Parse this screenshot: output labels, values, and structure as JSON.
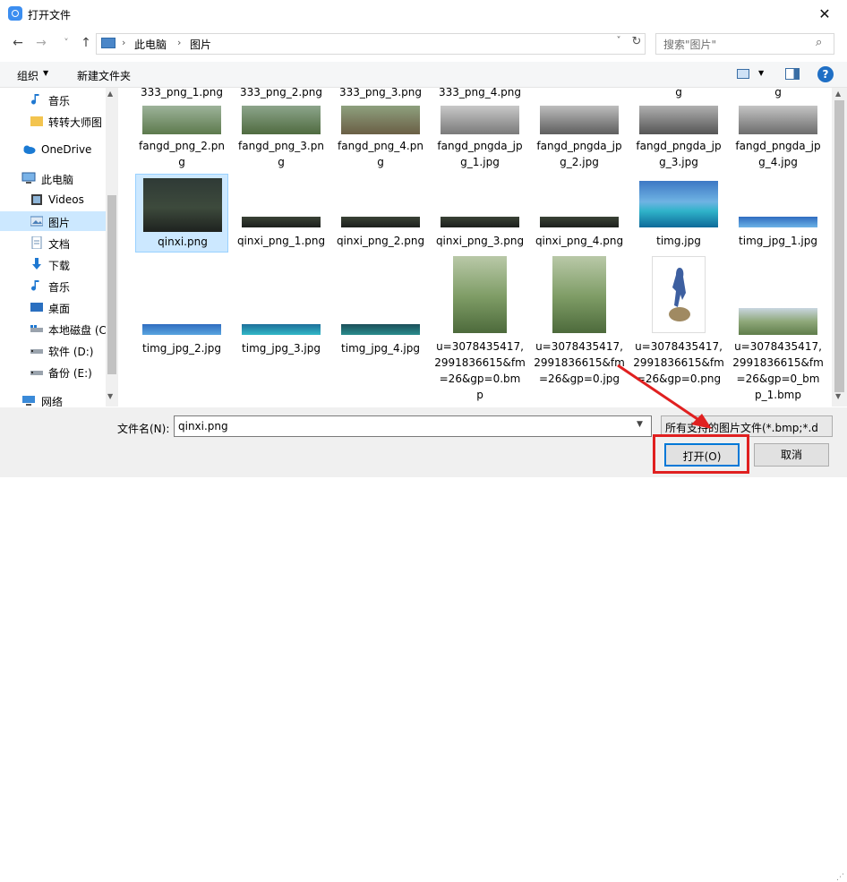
{
  "window": {
    "title": "打开文件",
    "close": "✕"
  },
  "nav": {
    "back": "←",
    "forward": "→",
    "recent": "˅",
    "up": "↑",
    "breadcrumb": [
      "此电脑",
      "图片"
    ],
    "crumb_sep": "›",
    "dropdown": "˅",
    "refresh": "↻",
    "search_placeholder": "搜索\"图片\"",
    "search_icon": "⌕"
  },
  "toolbar": {
    "organize": "组织",
    "organize_arrow": "▼",
    "new_folder": "新建文件夹",
    "view_arrow": "▼",
    "help": "?"
  },
  "sidebar": {
    "items": [
      {
        "label": "音乐",
        "icon": "music-icon"
      },
      {
        "label": "转转大师图",
        "icon": "folder-icon"
      },
      {
        "label": "OneDrive",
        "icon": "cloud-icon"
      },
      {
        "label": "此电脑",
        "icon": "computer-icon"
      },
      {
        "label": "Videos",
        "icon": "video-icon"
      },
      {
        "label": "图片",
        "icon": "pictures-icon"
      },
      {
        "label": "文档",
        "icon": "document-icon"
      },
      {
        "label": "下载",
        "icon": "download-icon"
      },
      {
        "label": "音乐",
        "icon": "music-icon"
      },
      {
        "label": "桌面",
        "icon": "desktop-icon"
      },
      {
        "label": "本地磁盘 (C",
        "icon": "drive-icon"
      },
      {
        "label": "软件 (D:)",
        "icon": "drive-icon"
      },
      {
        "label": "备份 (E:)",
        "icon": "drive-icon"
      },
      {
        "label": "网络",
        "icon": "network-icon"
      }
    ],
    "scroll_up": "▲",
    "scroll_down": "▼"
  },
  "files": {
    "row0": [
      "333_png_1.png",
      "333_png_2.png",
      "333_png_3.png",
      "333_png_4.png",
      "g",
      "g"
    ],
    "row1": [
      {
        "name": "fangd_png_2.pn\ng",
        "thumb": "girl"
      },
      {
        "name": "fangd_png_3.pn\ng",
        "thumb": "girl2"
      },
      {
        "name": "fangd_png_4.pn\ng",
        "thumb": "dog"
      },
      {
        "name": "fangd_pngda_jp\ng_1.jpg",
        "thumb": "gray-dog"
      },
      {
        "name": "fangd_pngda_jp\ng_2.jpg",
        "thumb": "gray-girl"
      },
      {
        "name": "fangd_pngda_jp\ng_3.jpg",
        "thumb": "gray-girl"
      },
      {
        "name": "fangd_pngda_jp\ng_4.jpg",
        "thumb": "gray-dog"
      }
    ],
    "row2": [
      {
        "name": "qinxi.png",
        "selected": true
      },
      {
        "name": "qinxi_png_1.png"
      },
      {
        "name": "qinxi_png_2.png"
      },
      {
        "name": "qinxi_png_3.png"
      },
      {
        "name": "qinxi_png_4.png"
      },
      {
        "name": "timg.jpg"
      },
      {
        "name": "timg_jpg_1.jpg"
      }
    ],
    "row3": [
      {
        "name": "timg_jpg_2.jpg"
      },
      {
        "name": "timg_jpg_3.jpg"
      },
      {
        "name": "timg_jpg_4.jpg"
      },
      {
        "name": "u=3078435417,\n2991836615&fm\n=26&gp=0.bm\np"
      },
      {
        "name": "u=3078435417,\n2991836615&fm\n=26&gp=0.jpg"
      },
      {
        "name": "u=3078435417,\n2991836615&fm\n=26&gp=0.png"
      },
      {
        "name": "u=3078435417,\n2991836615&fm\n=26&gp=0_bm\np_1.bmp"
      }
    ],
    "scroll_up": "▲",
    "scroll_down": "▼"
  },
  "footer": {
    "filename_label": "文件名(N):",
    "filename_value": "qinxi.png",
    "filename_drop": "▼",
    "filter": "所有支持的图片文件(*.bmp;*.d",
    "open": "打开(O)",
    "cancel": "取消"
  },
  "colors": {
    "selection": "#cce8ff",
    "accent": "#0078d7",
    "annotation": "#e02020"
  }
}
